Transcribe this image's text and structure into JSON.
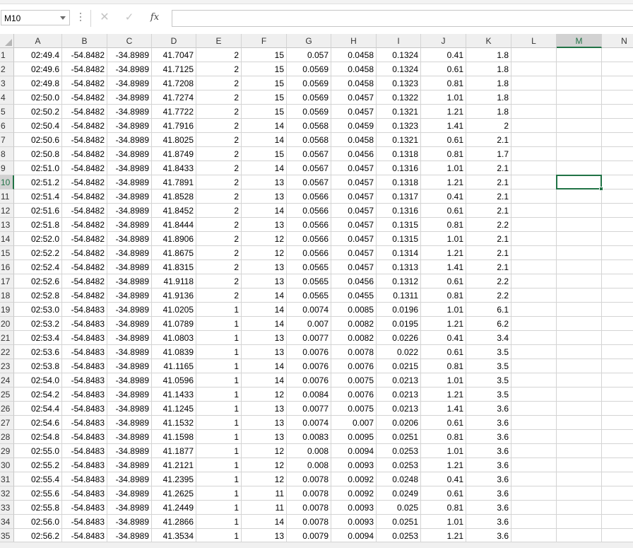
{
  "name_box": "M10",
  "formula": "",
  "toolbar_icons": {
    "cancel": "✕",
    "enter": "✓",
    "fx": "fx"
  },
  "colors": {
    "accent": "#217346",
    "header_bg": "#efefef",
    "gridline": "#d4d4d4"
  },
  "selected": {
    "col": "M",
    "row": 10
  },
  "columns": [
    "A",
    "B",
    "C",
    "D",
    "E",
    "F",
    "G",
    "H",
    "I",
    "J",
    "K",
    "L",
    "M",
    "N"
  ],
  "rows": [
    [
      "02:49.4",
      "-54.8482",
      "-34.8989",
      "41.7047",
      "2",
      "15",
      "0.057",
      "0.0458",
      "0.1324",
      "0.41",
      "1.8"
    ],
    [
      "02:49.6",
      "-54.8482",
      "-34.8989",
      "41.7125",
      "2",
      "15",
      "0.0569",
      "0.0458",
      "0.1324",
      "0.61",
      "1.8"
    ],
    [
      "02:49.8",
      "-54.8482",
      "-34.8989",
      "41.7208",
      "2",
      "15",
      "0.0569",
      "0.0458",
      "0.1323",
      "0.81",
      "1.8"
    ],
    [
      "02:50.0",
      "-54.8482",
      "-34.8989",
      "41.7274",
      "2",
      "15",
      "0.0569",
      "0.0457",
      "0.1322",
      "1.01",
      "1.8"
    ],
    [
      "02:50.2",
      "-54.8482",
      "-34.8989",
      "41.7722",
      "2",
      "15",
      "0.0569",
      "0.0457",
      "0.1321",
      "1.21",
      "1.8"
    ],
    [
      "02:50.4",
      "-54.8482",
      "-34.8989",
      "41.7916",
      "2",
      "14",
      "0.0568",
      "0.0459",
      "0.1323",
      "1.41",
      "2"
    ],
    [
      "02:50.6",
      "-54.8482",
      "-34.8989",
      "41.8025",
      "2",
      "14",
      "0.0568",
      "0.0458",
      "0.1321",
      "0.61",
      "2.1"
    ],
    [
      "02:50.8",
      "-54.8482",
      "-34.8989",
      "41.8749",
      "2",
      "15",
      "0.0567",
      "0.0456",
      "0.1318",
      "0.81",
      "1.7"
    ],
    [
      "02:51.0",
      "-54.8482",
      "-34.8989",
      "41.8433",
      "2",
      "14",
      "0.0567",
      "0.0457",
      "0.1316",
      "1.01",
      "2.1"
    ],
    [
      "02:51.2",
      "-54.8482",
      "-34.8989",
      "41.7891",
      "2",
      "13",
      "0.0567",
      "0.0457",
      "0.1318",
      "1.21",
      "2.1"
    ],
    [
      "02:51.4",
      "-54.8482",
      "-34.8989",
      "41.8528",
      "2",
      "13",
      "0.0566",
      "0.0457",
      "0.1317",
      "0.41",
      "2.1"
    ],
    [
      "02:51.6",
      "-54.8482",
      "-34.8989",
      "41.8452",
      "2",
      "14",
      "0.0566",
      "0.0457",
      "0.1316",
      "0.61",
      "2.1"
    ],
    [
      "02:51.8",
      "-54.8482",
      "-34.8989",
      "41.8444",
      "2",
      "13",
      "0.0566",
      "0.0457",
      "0.1315",
      "0.81",
      "2.2"
    ],
    [
      "02:52.0",
      "-54.8482",
      "-34.8989",
      "41.8906",
      "2",
      "12",
      "0.0566",
      "0.0457",
      "0.1315",
      "1.01",
      "2.1"
    ],
    [
      "02:52.2",
      "-54.8482",
      "-34.8989",
      "41.8675",
      "2",
      "12",
      "0.0566",
      "0.0457",
      "0.1314",
      "1.21",
      "2.1"
    ],
    [
      "02:52.4",
      "-54.8482",
      "-34.8989",
      "41.8315",
      "2",
      "13",
      "0.0565",
      "0.0457",
      "0.1313",
      "1.41",
      "2.1"
    ],
    [
      "02:52.6",
      "-54.8482",
      "-34.8989",
      "41.9118",
      "2",
      "13",
      "0.0565",
      "0.0456",
      "0.1312",
      "0.61",
      "2.2"
    ],
    [
      "02:52.8",
      "-54.8482",
      "-34.8989",
      "41.9136",
      "2",
      "14",
      "0.0565",
      "0.0455",
      "0.1311",
      "0.81",
      "2.2"
    ],
    [
      "02:53.0",
      "-54.8483",
      "-34.8989",
      "41.0205",
      "1",
      "14",
      "0.0074",
      "0.0085",
      "0.0196",
      "1.01",
      "6.1"
    ],
    [
      "02:53.2",
      "-54.8483",
      "-34.8989",
      "41.0789",
      "1",
      "14",
      "0.007",
      "0.0082",
      "0.0195",
      "1.21",
      "6.2"
    ],
    [
      "02:53.4",
      "-54.8483",
      "-34.8989",
      "41.0803",
      "1",
      "13",
      "0.0077",
      "0.0082",
      "0.0226",
      "0.41",
      "3.4"
    ],
    [
      "02:53.6",
      "-54.8483",
      "-34.8989",
      "41.0839",
      "1",
      "13",
      "0.0076",
      "0.0078",
      "0.022",
      "0.61",
      "3.5"
    ],
    [
      "02:53.8",
      "-54.8483",
      "-34.8989",
      "41.1165",
      "1",
      "14",
      "0.0076",
      "0.0076",
      "0.0215",
      "0.81",
      "3.5"
    ],
    [
      "02:54.0",
      "-54.8483",
      "-34.8989",
      "41.0596",
      "1",
      "14",
      "0.0076",
      "0.0075",
      "0.0213",
      "1.01",
      "3.5"
    ],
    [
      "02:54.2",
      "-54.8483",
      "-34.8989",
      "41.1433",
      "1",
      "12",
      "0.0084",
      "0.0076",
      "0.0213",
      "1.21",
      "3.5"
    ],
    [
      "02:54.4",
      "-54.8483",
      "-34.8989",
      "41.1245",
      "1",
      "13",
      "0.0077",
      "0.0075",
      "0.0213",
      "1.41",
      "3.6"
    ],
    [
      "02:54.6",
      "-54.8483",
      "-34.8989",
      "41.1532",
      "1",
      "13",
      "0.0074",
      "0.007",
      "0.0206",
      "0.61",
      "3.6"
    ],
    [
      "02:54.8",
      "-54.8483",
      "-34.8989",
      "41.1598",
      "1",
      "13",
      "0.0083",
      "0.0095",
      "0.0251",
      "0.81",
      "3.6"
    ],
    [
      "02:55.0",
      "-54.8483",
      "-34.8989",
      "41.1877",
      "1",
      "12",
      "0.008",
      "0.0094",
      "0.0253",
      "1.01",
      "3.6"
    ],
    [
      "02:55.2",
      "-54.8483",
      "-34.8989",
      "41.2121",
      "1",
      "12",
      "0.008",
      "0.0093",
      "0.0253",
      "1.21",
      "3.6"
    ],
    [
      "02:55.4",
      "-54.8483",
      "-34.8989",
      "41.2395",
      "1",
      "12",
      "0.0078",
      "0.0092",
      "0.0248",
      "0.41",
      "3.6"
    ],
    [
      "02:55.6",
      "-54.8483",
      "-34.8989",
      "41.2625",
      "1",
      "11",
      "0.0078",
      "0.0092",
      "0.0249",
      "0.61",
      "3.6"
    ],
    [
      "02:55.8",
      "-54.8483",
      "-34.8989",
      "41.2449",
      "1",
      "11",
      "0.0078",
      "0.0093",
      "0.025",
      "0.81",
      "3.6"
    ],
    [
      "02:56.0",
      "-54.8483",
      "-34.8989",
      "41.2866",
      "1",
      "14",
      "0.0078",
      "0.0093",
      "0.0251",
      "1.01",
      "3.6"
    ],
    [
      "02:56.2",
      "-54.8483",
      "-34.8989",
      "41.3534",
      "1",
      "13",
      "0.0079",
      "0.0094",
      "0.0253",
      "1.21",
      "3.6"
    ]
  ]
}
